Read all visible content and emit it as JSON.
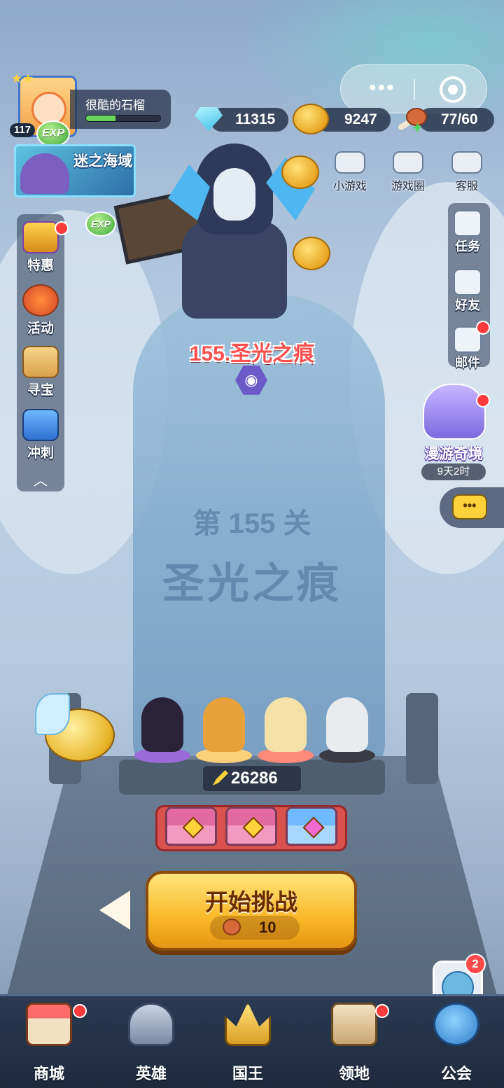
{
  "player": {
    "name": "很酷的石榴",
    "level": "117",
    "exp_progress": 0.4,
    "exp_tag": "EXP",
    "avatar_stars": 2
  },
  "currencies": {
    "gems": "11315",
    "gold": "9247",
    "stamina": "77/60"
  },
  "event_banner": {
    "label": "迷之海域"
  },
  "top_utilities": [
    {
      "label": "小游戏",
      "icon": "gamepad-icon"
    },
    {
      "label": "游戏圈",
      "icon": "game-circle-icon"
    },
    {
      "label": "客服",
      "icon": "customer-service-icon"
    }
  ],
  "left_menu": [
    {
      "label": "特惠",
      "icon": "deal-icon",
      "has_dot": true
    },
    {
      "label": "活动",
      "icon": "event-icon",
      "has_dot": false
    },
    {
      "label": "寻宝",
      "icon": "treasure-map-icon",
      "has_dot": false
    },
    {
      "label": "冲刺",
      "icon": "sprint-trophy-icon",
      "has_dot": false
    }
  ],
  "right_menu": [
    {
      "label": "任务",
      "icon": "task-calendar-icon",
      "has_dot": false
    },
    {
      "label": "好友",
      "icon": "friends-icon",
      "has_dot": false
    },
    {
      "label": "邮件",
      "icon": "mail-icon",
      "has_dot": true
    }
  ],
  "wander_event": {
    "label": "漫游奇境",
    "timer": "9天2时"
  },
  "stage": {
    "name": "155.圣光之痕",
    "floor_level": "第 155 关",
    "floor_title": "圣光之痕"
  },
  "team": {
    "power": "26286"
  },
  "start_button": {
    "label": "开始挑战",
    "cost": "10"
  },
  "guild_notice": {
    "count": "2"
  },
  "bottom_nav": [
    {
      "label": "商城",
      "icon": "shop-icon",
      "has_dot": true
    },
    {
      "label": "英雄",
      "icon": "hero-helmet-icon",
      "has_dot": false
    },
    {
      "label": "国王",
      "icon": "king-crown-icon",
      "has_dot": false
    },
    {
      "label": "领地",
      "icon": "territory-castle-icon",
      "has_dot": true
    },
    {
      "label": "公会",
      "icon": "guild-planet-icon",
      "has_dot": false
    }
  ],
  "colors": {
    "accent_gold": "#f9b829",
    "stage_red": "#ff4f4f",
    "notification_red": "#ff3b3b",
    "exp_green": "#69d65a"
  }
}
